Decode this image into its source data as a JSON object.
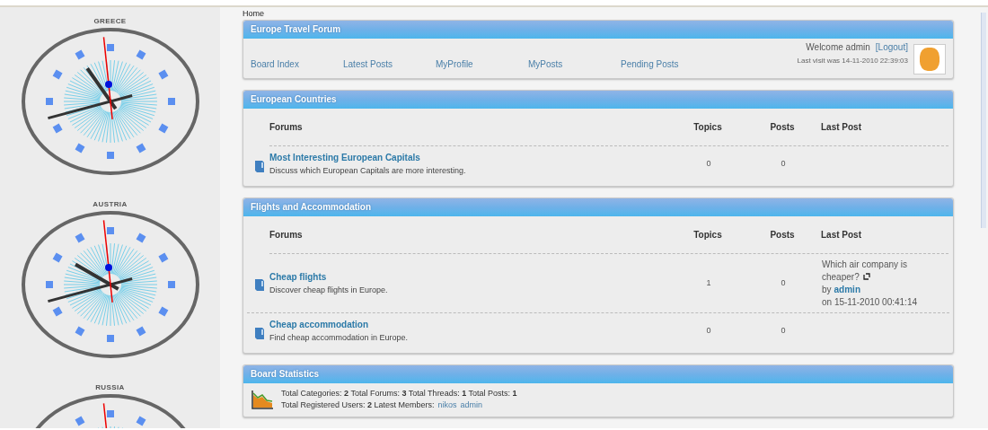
{
  "sidebar": {
    "clocks": [
      {
        "label": "GREECE"
      },
      {
        "label": "AUSTRIA"
      },
      {
        "label": "RUSSIA"
      }
    ]
  },
  "breadcrumb": "Home",
  "header": {
    "title": "Europe Travel Forum",
    "nav": [
      "Board Index",
      "Latest Posts",
      "MyProfile",
      "MyPosts",
      "Pending Posts"
    ],
    "welcome": "Welcome admin",
    "logout": "[Logout]",
    "last_visit": "Last visit was 14-11-2010 22:39:03"
  },
  "categories": [
    {
      "title": "European Countries",
      "columns": [
        "Forums",
        "Topics",
        "Posts",
        "Last Post"
      ],
      "forums": [
        {
          "name": "Most Interesting European Capitals",
          "description": "Discuss which European Capitals are more interesting.",
          "topics": "0",
          "posts": "0"
        }
      ]
    },
    {
      "title": "Flights and Accommodation",
      "columns": [
        "Forums",
        "Topics",
        "Posts",
        "Last Post"
      ],
      "forums": [
        {
          "name": "Cheap flights",
          "description": "Discover cheap flights in Europe.",
          "topics": "1",
          "posts": "0",
          "last_post": {
            "title": "Which air company is cheaper?",
            "by": "by",
            "author": "admin",
            "date": "on 15-11-2010 00:41:14"
          }
        },
        {
          "name": "Cheap accommodation",
          "description": "Find cheap accommodation in Europe.",
          "topics": "0",
          "posts": "0"
        }
      ]
    }
  ],
  "statistics": {
    "title": "Board Statistics",
    "lines": [
      {
        "text": "Total Categories: **2** Total Forums: **3** Total Threads: **1** Total Posts: **1**"
      },
      {
        "text": "Total Registered Users: **2** Latest Members:",
        "links": [
          "nikos",
          "admin"
        ]
      }
    ]
  }
}
